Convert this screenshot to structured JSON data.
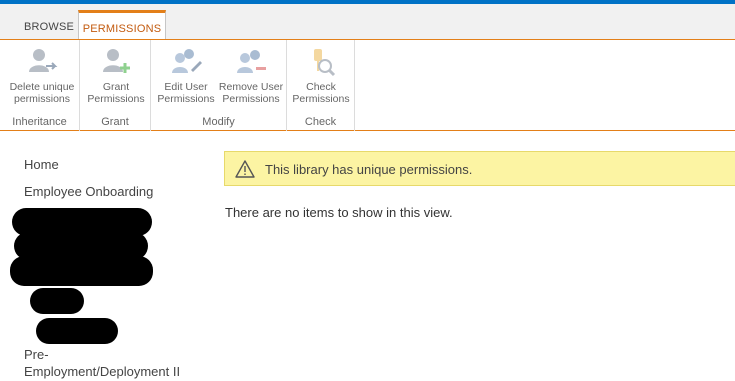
{
  "tabs": {
    "browse": "BROWSE",
    "permissions": "PERMISSIONS"
  },
  "ribbon": {
    "groups": {
      "inheritance": "Inheritance",
      "grant": "Grant",
      "modify": "Modify",
      "check": "Check"
    },
    "buttons": {
      "delete_unique_line1": "Delete unique",
      "delete_unique_line2": "permissions",
      "grant_line1": "Grant",
      "grant_line2": "Permissions",
      "edit_user_line1": "Edit User",
      "edit_user_line2": "Permissions",
      "remove_user_line1": "Remove User",
      "remove_user_line2": "Permissions",
      "check_line1": "Check",
      "check_line2": "Permissions"
    }
  },
  "nav": {
    "home": "Home",
    "employee_onboarding": "Employee Onboarding",
    "pre_employment_line1": "Pre-",
    "pre_employment_line2": "Employment/Deployment II"
  },
  "notice": {
    "text": "This library has unique permissions."
  },
  "content": {
    "empty_message": "There are no items to show in this view."
  },
  "colors": {
    "accent": "#e37f18",
    "suite_blue": "#0072c6",
    "notice_bg": "#fcf4a3"
  }
}
